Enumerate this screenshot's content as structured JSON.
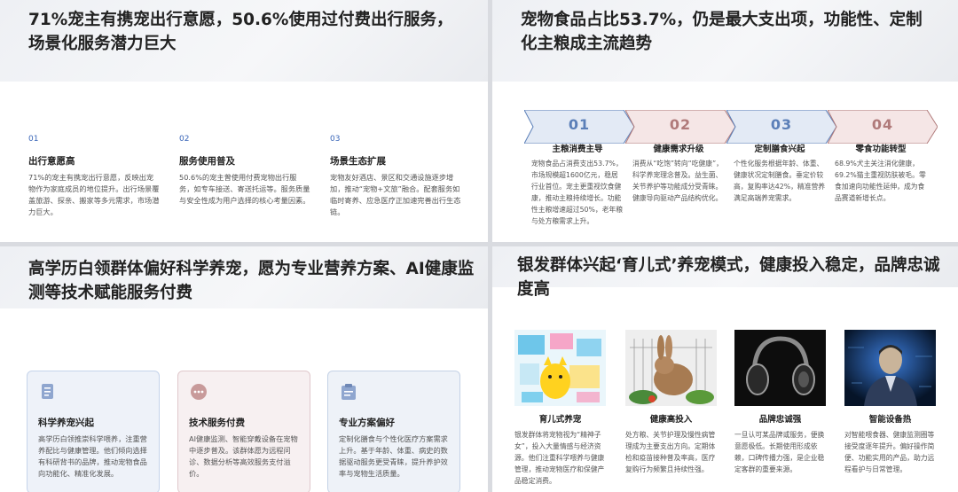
{
  "panel1": {
    "title": "71%宠主有携宠出行意愿，50.6%使用过付费出行服务，场景化服务潜力巨大",
    "columns": [
      {
        "num": "01",
        "heading": "出行意愿高",
        "text": "71%的宠主有携宠出行意愿，反映出宠物作为家庭成员的地位提升。出行场景覆盖旅游、探亲、搬家等多元需求，市场潜力巨大。"
      },
      {
        "num": "02",
        "heading": "服务使用普及",
        "text": "50.6%的宠主曾使用付费宠物出行服务，如专车接送、寄送托运等。服务质量与安全性成为用户选择的核心考量因素。"
      },
      {
        "num": "03",
        "heading": "场景生态扩展",
        "text": "宠物友好酒店、景区和交通设施逐步增加，推动“宠物+文旅”融合。配套服务如临时寄养、应急医疗正加速完善出行生态链。"
      }
    ]
  },
  "panel2": {
    "title": "宠物食品占比53.7%，仍是最大支出项，功能性、定制化主粮成主流趋势",
    "steps": [
      {
        "num": "01",
        "color": "#5b7fb8",
        "fill": "#e3eaf5",
        "heading": "主粮消费主导",
        "text": "宠物食品占消费支出53.7%，市场规模超1600亿元，稳居行业首位。宠主更重视饮食健康，推动主粮持续增长。功能性主粮增速超过50%，老年粮与处方粮需求上升。"
      },
      {
        "num": "02",
        "color": "#b07a7a",
        "fill": "#f5e6e6",
        "heading": "健康需求升级",
        "text": "消费从“吃饱”转向“吃健康”，科学养宠理念普及。益生菌、关节养护等功能成分受青睐。健康导向驱动产品结构优化。"
      },
      {
        "num": "03",
        "color": "#5b7fb8",
        "fill": "#e3eaf5",
        "heading": "定制膳食兴起",
        "text": "个性化服务根据年龄、体重、健康状况定制膳食。垂定价较高，复购率达42%，精准营养满足高端养宠需求。"
      },
      {
        "num": "04",
        "color": "#b07a7a",
        "fill": "#f5e6e6",
        "heading": "零食功能转型",
        "text": "68.9%犬主关注消化健康，69.2%猫主重视防肤被毛。零食加速向功能性延伸，成为食品赛道新增长点。"
      }
    ]
  },
  "panel3": {
    "title": "高学历白领群体偏好科学养宠，愿为专业营养方案、AI健康监测等技术赋能服务付费",
    "cards": [
      {
        "icon": "document-icon",
        "heading": "科学养宠兴起",
        "text": "高学历白领推崇科学喂养，注重营养配比与健康管理。他们倾向选择有科研背书的品牌，推动宠物食品向功能化、精准化发展。"
      },
      {
        "icon": "chat-bubble-icon",
        "heading": "技术服务付费",
        "text": "AI健康监测、智能穿戴设备在宠物中逐步普及。该群体愿为远程问诊、数据分析等高效服务支付溢价。"
      },
      {
        "icon": "clipboard-icon",
        "heading": "专业方案偏好",
        "text": "定制化膳食与个性化医疗方案需求上升。基于年龄、体重、病史的数据驱动服务更受青睐，提升养护效率与宠物生活质量。"
      }
    ]
  },
  "panel4": {
    "title": "银发群体兴起‘育儿式’养宠模式，健康投入稳定，品牌忠诚度高",
    "items": [
      {
        "image": "cartoon-pets-illustration",
        "heading": "育儿式养宠",
        "text": "银发群体将宠物视为“精神子女”，投入大量情感与经济资源。他们注重科学喂养与健康管理，推动宠物医疗和保健产品稳定消费。"
      },
      {
        "image": "rabbit-photo",
        "heading": "健康高投入",
        "text": "处方粮、关节护理及慢性病管理成为主要支出方向。定期体检和疫苗接种普及率高，医疗复购行为频繁且持续性强。"
      },
      {
        "image": "headphones-photo",
        "heading": "品牌忠诚强",
        "text": "一旦认可某品牌或服务，便换意愿极低。长期使用形成依赖，口碑传播力强，是企业稳定客群的重要来源。"
      },
      {
        "image": "robot-figure-photo",
        "heading": "智能设备热",
        "text": "对智能喂食器、健康监测圈等接受度逐年提升。偏好操作简便、功能实用的产品，助力远程看护与日常管理。"
      }
    ]
  }
}
